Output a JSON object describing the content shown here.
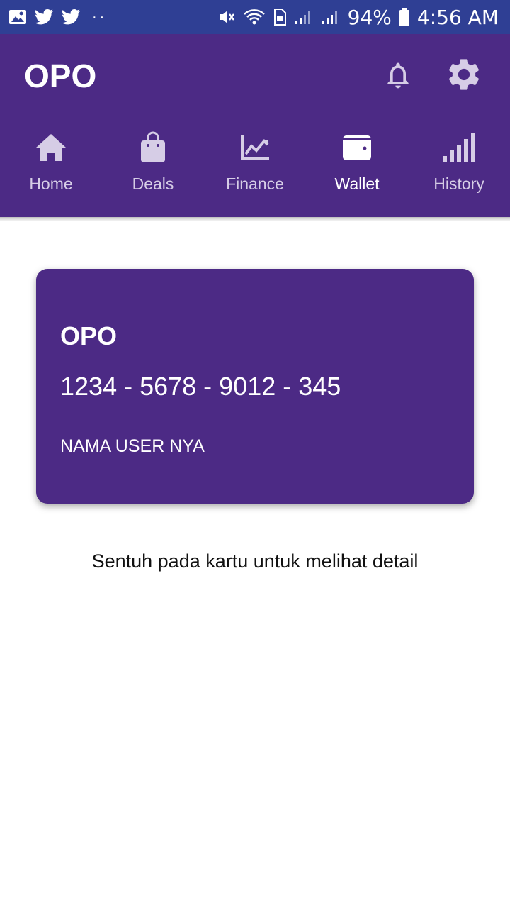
{
  "status_bar": {
    "battery": "94%",
    "time": "4:56 AM",
    "dots": "··",
    "left_icons": [
      "gallery-icon",
      "twitter-icon",
      "twitter-icon"
    ],
    "right_icons": [
      "mute-icon",
      "wifi-icon",
      "sim-icon",
      "signal-icon",
      "signal-icon",
      "battery-icon"
    ]
  },
  "app_bar": {
    "title": "OPO",
    "actions": [
      "bell-icon",
      "gear-icon"
    ]
  },
  "tabs": [
    {
      "label": "Home",
      "icon": "home-icon"
    },
    {
      "label": "Deals",
      "icon": "shopping-bag-icon"
    },
    {
      "label": "Finance",
      "icon": "chart-icon"
    },
    {
      "label": "Wallet",
      "icon": "wallet-icon",
      "active": true
    },
    {
      "label": "History",
      "icon": "bars-icon"
    }
  ],
  "card": {
    "title": "OPO",
    "number": "1234 - 5678 - 9012 - 345",
    "holder": "NAMA USER NYA"
  },
  "hint": "Sentuh pada kartu untuk melihat detail",
  "colors": {
    "status_bar": "#2f3f94",
    "primary": "#4c2a85",
    "inactive_tab": "#d6cde6",
    "active_tab": "#ffffff"
  }
}
